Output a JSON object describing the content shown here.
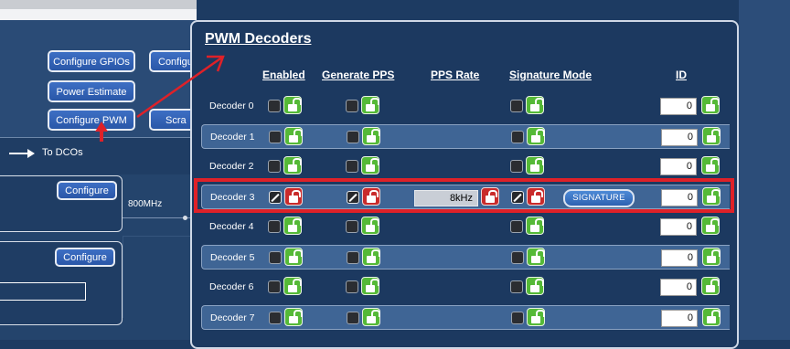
{
  "background": {
    "buttons": {
      "configure_gpios": "Configure GPIOs",
      "configure_truncated": "Configu",
      "power_estimate": "Power Estimate",
      "configure_pwm": "Configure PWM",
      "scratch_truncated": "Scra"
    },
    "dco_label": "To DCOs",
    "configure_a": "Configure",
    "configure_b": "Configure",
    "frequency_label": "800MHz"
  },
  "pwm": {
    "title": "PWM Decoders",
    "headers": {
      "enabled": "Enabled",
      "generate_pps": "Generate PPS",
      "pps_rate": "PPS Rate",
      "signature_mode": "Signature Mode",
      "id": "ID"
    },
    "decoders": [
      {
        "name": "Decoder 0",
        "enabled": false,
        "generate_pps": false,
        "signature_mode": false,
        "locked": false,
        "id": "0"
      },
      {
        "name": "Decoder 1",
        "enabled": false,
        "generate_pps": false,
        "signature_mode": false,
        "locked": false,
        "id": "0"
      },
      {
        "name": "Decoder 2",
        "enabled": false,
        "generate_pps": false,
        "signature_mode": false,
        "locked": false,
        "id": "0"
      },
      {
        "name": "Decoder 3",
        "enabled": true,
        "generate_pps": true,
        "signature_mode": true,
        "locked": true,
        "pps_rate": "8kHz",
        "signature_button": "SIGNATURE",
        "id": "0"
      },
      {
        "name": "Decoder 4",
        "enabled": false,
        "generate_pps": false,
        "signature_mode": false,
        "locked": false,
        "id": "0"
      },
      {
        "name": "Decoder 5",
        "enabled": false,
        "generate_pps": false,
        "signature_mode": false,
        "locked": false,
        "id": "0"
      },
      {
        "name": "Decoder 6",
        "enabled": false,
        "generate_pps": false,
        "signature_mode": false,
        "locked": false,
        "id": "0"
      },
      {
        "name": "Decoder 7",
        "enabled": false,
        "generate_pps": false,
        "signature_mode": false,
        "locked": false,
        "id": "0"
      }
    ]
  },
  "colors": {
    "panel": "#1c3960",
    "row_alt": "#3f6595",
    "lock_open": "#55b937",
    "lock_closed": "#c92b2b",
    "annotation": "#df2128"
  }
}
